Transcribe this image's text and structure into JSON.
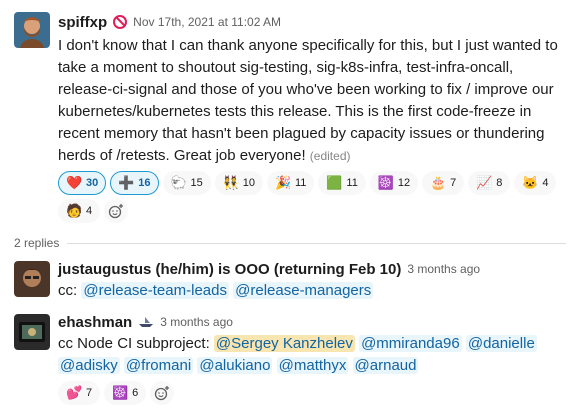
{
  "parent": {
    "author": "spiffxp",
    "status_icon": "no-entry-icon",
    "timestamp": "Nov 17th, 2021 at 11:02 AM",
    "text": "I don't know that I can thank anyone specifically for this, but I just wanted to take a moment to shoutout sig-testing, sig-k8s-infra, test-infra-oncall, release-ci-signal and those of you who've been working to fix / improve our kubernetes/kubernetes tests this release.  This is the first code-freeze in recent memory that hasn't been plagued by capacity issues or thundering herds of /retests.  Great job everyone!",
    "edited": "(edited)",
    "reactions": [
      {
        "icon": "heart-icon",
        "glyph": "❤️",
        "count": "30",
        "active": true
      },
      {
        "icon": "plus-icon",
        "glyph": "➕",
        "count": "16",
        "active": true
      },
      {
        "icon": "herd-icon",
        "glyph": "🐑",
        "count": "15",
        "active": false
      },
      {
        "icon": "people-icon",
        "glyph": "👯",
        "count": "10",
        "active": false
      },
      {
        "icon": "tada-icon",
        "glyph": "🎉",
        "count": "11",
        "active": false
      },
      {
        "icon": "green-grid-icon",
        "glyph": "🟩",
        "count": "11",
        "active": false
      },
      {
        "icon": "kubernetes-icon",
        "glyph": "☸️",
        "count": "12",
        "active": false
      },
      {
        "icon": "cake-icon",
        "glyph": "🎂",
        "count": "7",
        "active": false
      },
      {
        "icon": "chart-icon",
        "glyph": "📈",
        "count": "8",
        "active": false
      },
      {
        "icon": "cat-icon",
        "glyph": "🐱",
        "count": "4",
        "active": false
      },
      {
        "icon": "person-icon",
        "glyph": "🧑",
        "count": "4",
        "active": false
      }
    ]
  },
  "replies_label": "2 replies",
  "reply1": {
    "author": "justaugustus (he/him) is OOO (returning Feb 10)",
    "timestamp": "3 months ago",
    "prefix": "cc: ",
    "mentions": [
      "@release-team-leads",
      "@release-managers"
    ]
  },
  "reply2": {
    "author": "ehashman",
    "status_icon": "boat-icon",
    "timestamp": "3 months ago",
    "prefix": "cc Node CI subproject: ",
    "mentions": [
      "@Sergey Kanzhelev",
      "@mmiranda96",
      "@danielle",
      "@adisky",
      "@fromani",
      "@alukiano",
      "@matthyx",
      "@arnaud"
    ],
    "reactions": [
      {
        "icon": "pink-hearts-icon",
        "glyph": "💕",
        "count": "7",
        "active": false
      },
      {
        "icon": "kubernetes-icon",
        "glyph": "☸️",
        "count": "6",
        "active": false
      }
    ]
  },
  "colors": {
    "link": "#1264a3",
    "accent": "#1d9bd1",
    "mention_self_bg": "#f8e5b0",
    "status_red": "#e01e5a"
  }
}
